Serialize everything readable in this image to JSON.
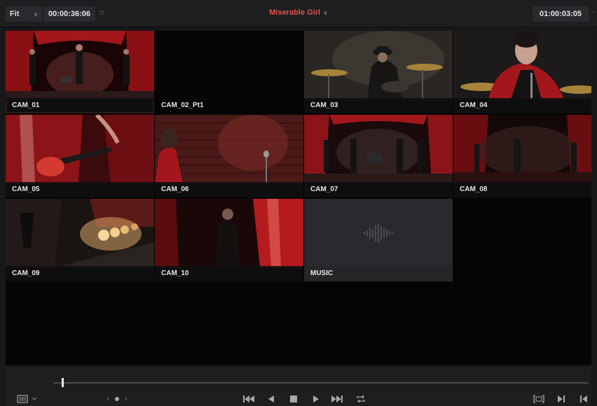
{
  "header": {
    "zoom_label": "Fit",
    "source_timecode": "00:00:36:06",
    "timeline_title": "Miserable Girl",
    "record_timecode": "01:00:03:05"
  },
  "angles": [
    {
      "label": "CAM_01"
    },
    {
      "label": "CAM_02_Pt1"
    },
    {
      "label": "CAM_03"
    },
    {
      "label": "CAM_04"
    },
    {
      "label": "CAM_05"
    },
    {
      "label": "CAM_06"
    },
    {
      "label": "CAM_07"
    },
    {
      "label": "CAM_08"
    },
    {
      "label": "CAM_09"
    },
    {
      "label": "CAM_10"
    },
    {
      "label": "MUSIC"
    }
  ],
  "colors": {
    "accent": "#e0554a",
    "background": "#18181a",
    "viewer": "#050506"
  },
  "transport": {
    "icons": [
      "viewer-layout-icon",
      "prev-angle-icon",
      "next-angle-icon",
      "jump-to-start-icon",
      "reverse-icon",
      "stop-icon",
      "play-icon",
      "jump-to-end-icon",
      "loop-icon",
      "match-frame-icon",
      "next-edit-icon",
      "prev-edit-icon"
    ]
  }
}
